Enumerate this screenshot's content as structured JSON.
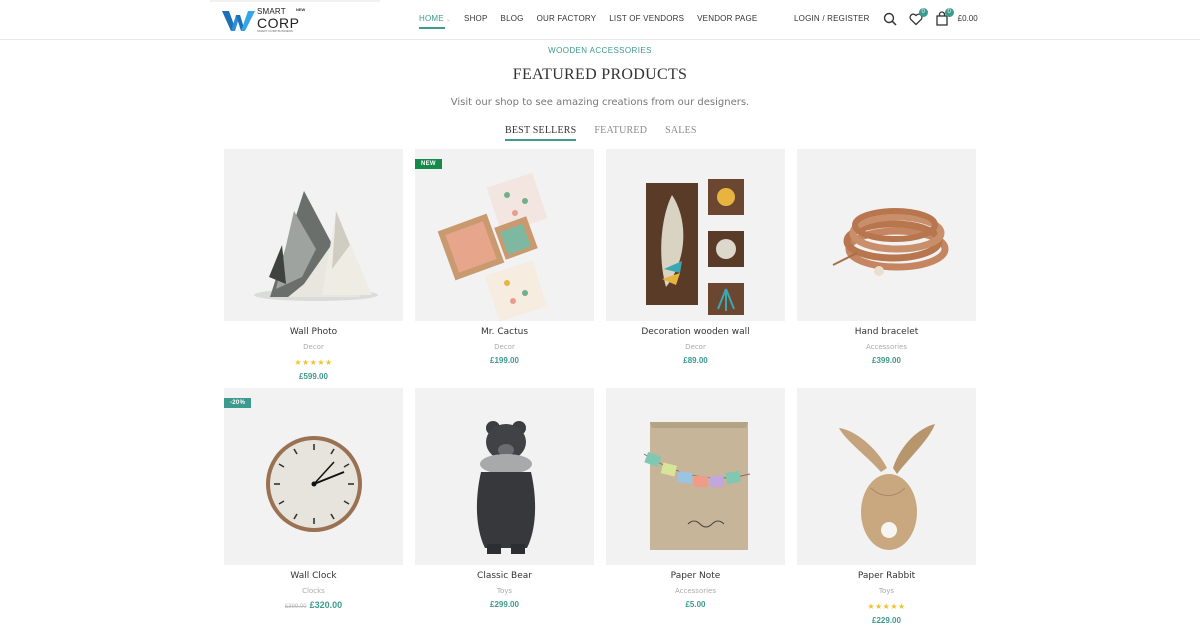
{
  "brand": {
    "line1": "SMART",
    "line2": "CORP",
    "tagline": "SMART CORP BUSINESS",
    "badge": "NEW"
  },
  "nav": [
    {
      "label": "HOME",
      "active": true
    },
    {
      "label": "SHOP"
    },
    {
      "label": "BLOG"
    },
    {
      "label": "OUR FACTORY"
    },
    {
      "label": "LIST OF VENDORS"
    },
    {
      "label": "VENDOR PAGE"
    }
  ],
  "header_tools": {
    "login_label": "LOGIN / REGISTER",
    "search_icon": "search-icon",
    "wishlist_icon": "heart-icon",
    "wishlist_count": "0",
    "cart_icon": "shopping-bag-icon",
    "cart_count": "0",
    "cart_total": "£0.00"
  },
  "section": {
    "subtitle": "WOODEN ACCESSORIES",
    "title": "FEATURED PRODUCTS",
    "description": "Visit our shop to see amazing creations from our designers."
  },
  "tabs": [
    {
      "label": "BEST SELLERS",
      "active": true
    },
    {
      "label": "FEATURED"
    },
    {
      "label": "SALES"
    }
  ],
  "colors": {
    "accent": "#3d9a8e",
    "new_badge": "#168a4b",
    "stars": "#f3c12e",
    "card_bg": "#f1f2f1"
  },
  "products": [
    {
      "name": "Wall Photo",
      "category": "Decor",
      "rating": 5,
      "stars": "★★★★★",
      "price": "£599.00"
    },
    {
      "name": "Mr. Cactus",
      "category": "Decor",
      "badge": "NEW",
      "price": "£199.00"
    },
    {
      "name": "Decoration wooden wall",
      "category": "Decor",
      "price": "£89.00"
    },
    {
      "name": "Hand bracelet",
      "category": "Accessories",
      "price": "£399.00"
    },
    {
      "name": "Wall Clock",
      "category": "Clocks",
      "badge": "-20%",
      "old_price": "£399.00",
      "price": "£320.00"
    },
    {
      "name": "Classic Bear",
      "category": "Toys",
      "price": "£299.00"
    },
    {
      "name": "Paper Note",
      "category": "Accessories",
      "price": "£5.00"
    },
    {
      "name": "Paper Rabbit",
      "category": "Toys",
      "rating": 5,
      "stars": "★★★★★",
      "price": "£229.00"
    }
  ]
}
